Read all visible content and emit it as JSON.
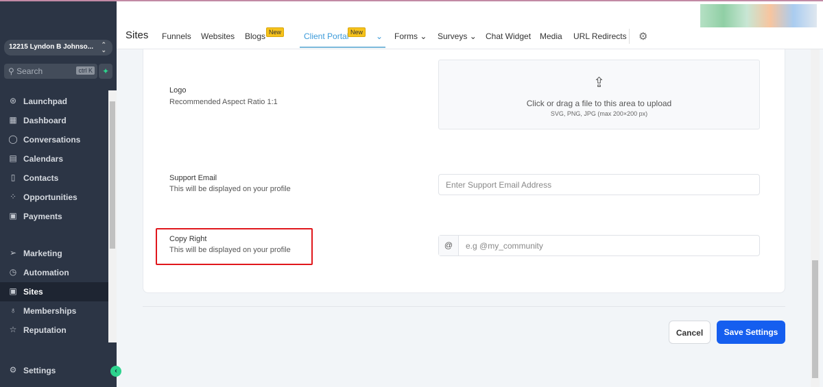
{
  "sidebar": {
    "location": "12215 Lyndon B Johnso...",
    "search_placeholder": "Search",
    "search_shortcut": "ctrl K",
    "items": [
      {
        "label": "Launchpad"
      },
      {
        "label": "Dashboard"
      },
      {
        "label": "Conversations"
      },
      {
        "label": "Calendars"
      },
      {
        "label": "Contacts"
      },
      {
        "label": "Opportunities"
      },
      {
        "label": "Payments"
      },
      {
        "label": "Marketing"
      },
      {
        "label": "Automation"
      },
      {
        "label": "Sites"
      },
      {
        "label": "Memberships"
      },
      {
        "label": "Reputation"
      }
    ],
    "settings": "Settings"
  },
  "header": {
    "title": "Sites",
    "tabs": [
      "Funnels",
      "Websites",
      "Blogs",
      "Client Portal",
      "Forms",
      "Surveys",
      "Chat Widget",
      "Media",
      "URL Redirects"
    ],
    "badge": "New"
  },
  "form": {
    "logo_label": "Logo",
    "logo_sub": "Recommended Aspect Ratio 1:1",
    "upload_text": "Click or drag a file to this area to upload",
    "upload_hint": "SVG, PNG, JPG (max 200×200 px)",
    "email_label": "Support Email",
    "email_sub": "This will be displayed on your profile",
    "email_placeholder": "Enter Support Email Address",
    "copy_label": "Copy Right",
    "copy_sub": "This will be displayed on your profile",
    "copy_prefix": "@",
    "copy_placeholder": "e.g @my_community"
  },
  "actions": {
    "cancel": "Cancel",
    "save": "Save Settings"
  }
}
